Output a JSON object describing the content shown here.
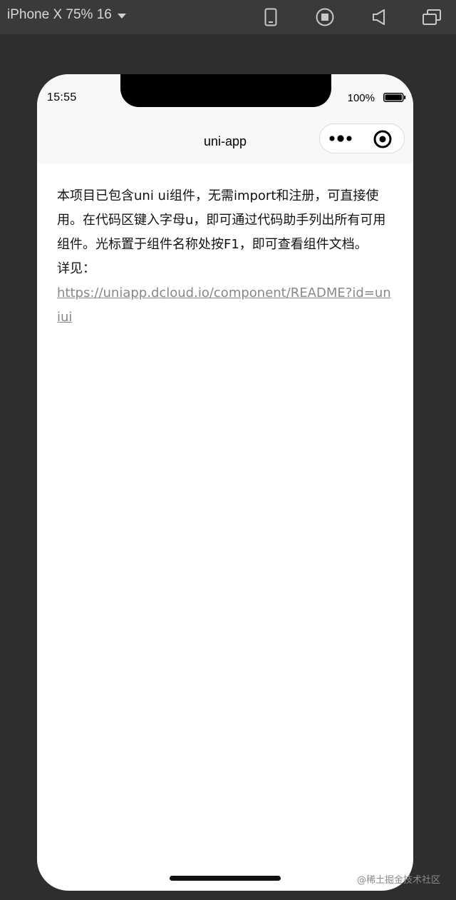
{
  "toolbar": {
    "device_label": "iPhone X 75% 16",
    "icons": [
      "phone-icon",
      "record-icon",
      "volume-icon",
      "window-icon"
    ]
  },
  "status_bar": {
    "time": "15:55",
    "battery": "100%"
  },
  "nav": {
    "title": "uni-app"
  },
  "content": {
    "description": "本项目已包含uni ui组件，无需import和注册，可直接使用。在代码区键入字母u，即可通过代码助手列出所有可用组件。光标置于组件名称处按F1，即可查看组件文档。",
    "see_label": "详见：",
    "link": "https://uniapp.dcloud.io/component/README?id=uniui"
  },
  "watermark": "@稀土掘金技术社区",
  "colors": {
    "toolbar_bg": "#3a3a3a",
    "page_bg": "#2e2e2e",
    "nav_bg": "#f8f8f8",
    "link": "#888888"
  }
}
